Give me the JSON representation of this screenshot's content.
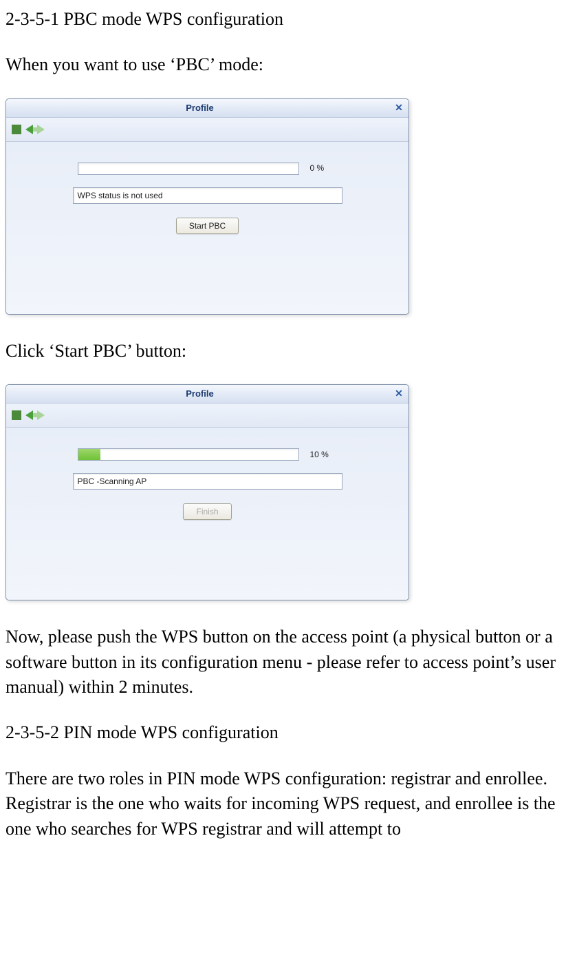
{
  "section1": {
    "heading": "2-3-5-1 PBC mode WPS configuration",
    "intro": "When you want to use ‘PBC’ mode:"
  },
  "dialog1": {
    "title": "Profile",
    "progress_percent_label": "0 %",
    "progress_value": 0,
    "status_text": "WPS status is not used",
    "button_label": "Start PBC"
  },
  "mid_text": "Click ‘Start PBC’ button:",
  "dialog2": {
    "title": "Profile",
    "progress_percent_label": "10 %",
    "progress_value": 10,
    "status_text": "PBC -Scanning AP",
    "button_label": "Finish"
  },
  "after_text": "Now, please push the WPS button on the access point (a physical button or a software button in its configuration menu - please refer to access point’s user manual) within 2 minutes.",
  "section2": {
    "heading": "2-3-5-2 PIN mode WPS configuration",
    "body": "There are two roles in PIN mode WPS configuration: registrar and enrollee. Registrar is the one who waits for incoming WPS request, and enrollee is the one who searches for WPS registrar and will attempt to"
  }
}
